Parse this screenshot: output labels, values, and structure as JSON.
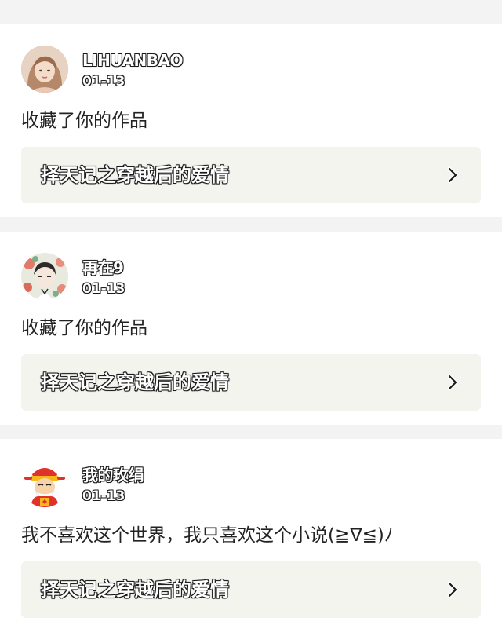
{
  "notifications": [
    {
      "username": "LIHUANBAO",
      "date": "01-13",
      "message": "收藏了你的作品",
      "work_title": "择天记之穿越后的爱情",
      "avatar": "girl-portrait-avatar"
    },
    {
      "username": "再在9",
      "date": "01-13",
      "message": "收藏了你的作品",
      "work_title": "择天记之穿越后的爱情",
      "avatar": "anime-boy-flowers-avatar"
    },
    {
      "username": "我的玫绢",
      "date": "01-13",
      "message": "我不喜欢这个世界，我只喜欢这个小说(≧∇≦)ﾉ",
      "work_title": "择天记之穿越后的爱情",
      "avatar": "god-of-wealth-avatar"
    }
  ],
  "colors": {
    "page_background": "#f3f3f3",
    "card_background": "#ffffff",
    "link_background": "#f4f4ee",
    "message_text": "#222222"
  }
}
